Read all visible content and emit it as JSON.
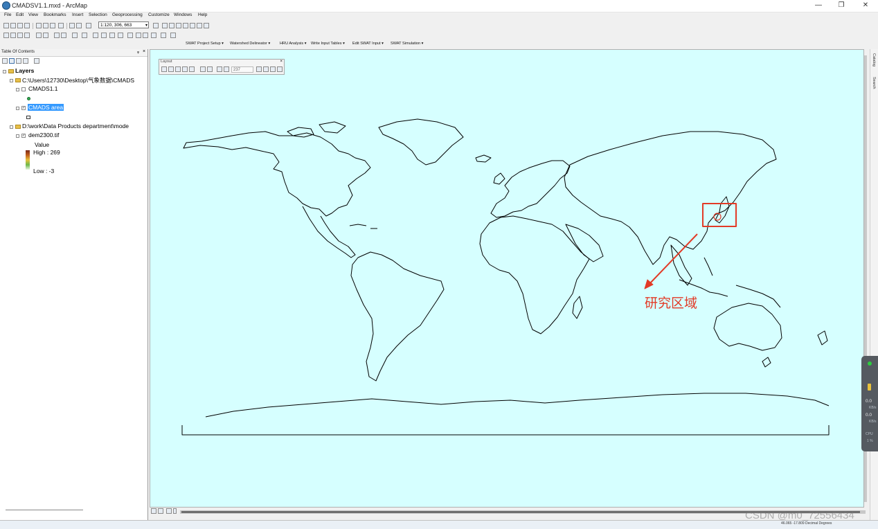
{
  "window": {
    "title": "CMADSV1.1.mxd - ArcMap",
    "controls": [
      "—",
      "❐",
      "✕"
    ]
  },
  "menu": [
    "File",
    "Edit",
    "View",
    "Bookmarks",
    "Insert",
    "Selection",
    "Geoprocessing",
    "Customize",
    "Windows",
    "Help"
  ],
  "toolbar": {
    "scale": "1:120, 306, 663"
  },
  "swat_toolbar": [
    "SWAT Project Setup ▾",
    "Watershed Delineator ▾",
    "HRU Analysis ▾",
    "Write Input Tables ▾",
    "Edit SWAT Input ▾",
    "SWAT Simulation ▾"
  ],
  "toc": {
    "title": "Table Of Contents",
    "root": "Layers",
    "group1_path": "C:\\Users\\12730\\Desktop\\气象数据\\CMADS",
    "layer_cmads": "CMADS1.1",
    "layer_area": "CMADS area",
    "group2_path": "D:\\work\\Data Products department\\mode",
    "layer_dem": "dem2300.tif",
    "legend_value": "Value",
    "legend_high": "High : 269",
    "legend_low": "Low : -3"
  },
  "layout_toolbar": {
    "title": "Layout",
    "zoom": "237"
  },
  "annotation": {
    "label": "研究区域",
    "color": "#e23a26"
  },
  "right_panel": {
    "catalog": "Catalog",
    "search": "Search"
  },
  "perf": {
    "up_value": "0.0",
    "up_unit": "KB/s",
    "down_value": "0.0",
    "down_unit": "KB/s",
    "cpu_label": "CPU",
    "cpu_value": "1 %"
  },
  "status": {
    "coords": "46.065  -17.809 Decimal Degrees"
  },
  "watermark": "CSDN @m0_72556434"
}
